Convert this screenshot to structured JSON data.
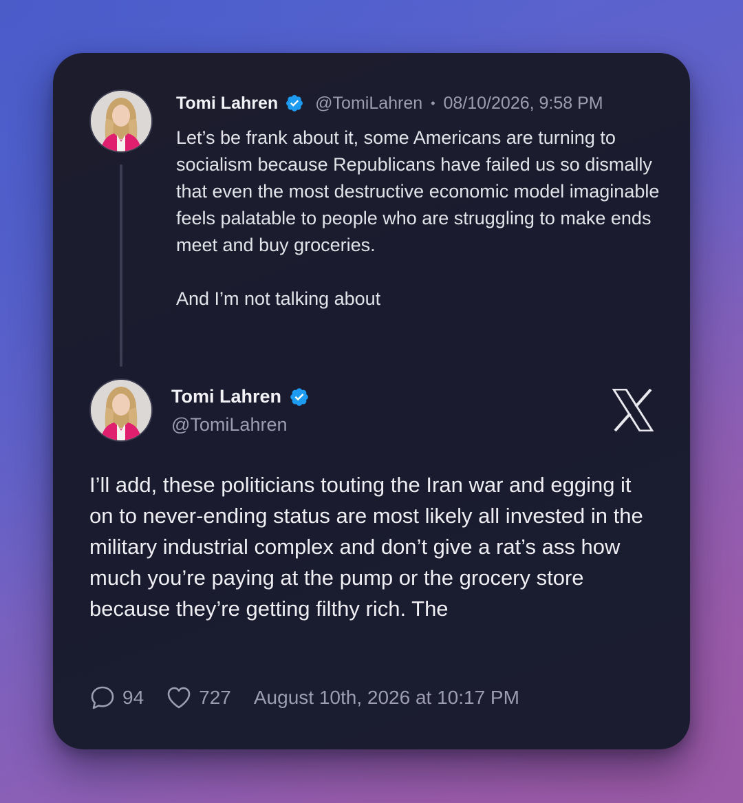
{
  "reply_tweet": {
    "author_name": "Tomi Lahren",
    "handle": "@TomiLahren",
    "separator": "•",
    "date": "08/10/2026, 9:58 PM",
    "paragraphs": [
      "Let’s be frank about it, some Americans are turning to socialism because Republicans have failed us so dismally that even the most destructive economic model imaginable feels palatable to people who are struggling to make ends meet and buy groceries.",
      "And I’m not talking about"
    ]
  },
  "main_tweet": {
    "author_name": "Tomi Lahren",
    "handle": "@TomiLahren",
    "text": "I’ll add, these politicians touting the Iran war and egging it on to never-ending status are most likely all invested in the military industrial complex and don’t give a rat’s ass how much you’re paying at the pump or the grocery store because they’re getting filthy rich. The",
    "reply_count": "94",
    "like_count": "727",
    "timestamp": "August 10th, 2026 at 10:17 PM"
  },
  "icons": {
    "verified": "verified-badge-icon",
    "brand": "x-logo-icon",
    "reply": "speech-bubble-icon",
    "like": "heart-icon"
  },
  "colors": {
    "verified_blue": "#1d9bf0",
    "card_background": "#1b1c2e",
    "muted_text": "#9d9db0",
    "avatar_jacket": "#e0206f"
  }
}
